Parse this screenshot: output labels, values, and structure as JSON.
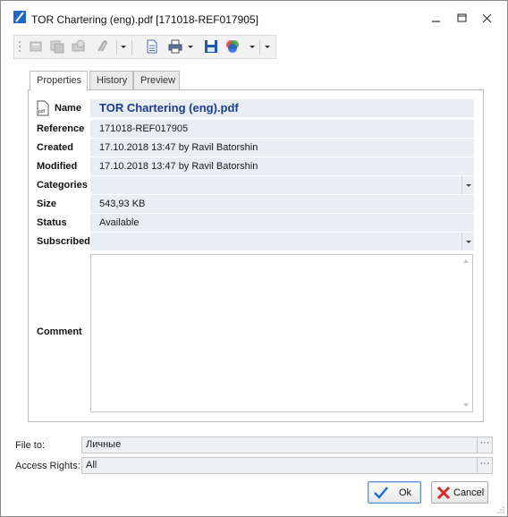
{
  "window": {
    "title": "TOR Chartering (eng).pdf [171018-REF017905]"
  },
  "titlebar_controls": {
    "minimize_icon": "minimize-icon",
    "restore_icon": "restore-icon",
    "close_icon": "close-icon"
  },
  "toolbar": {
    "icons": [
      "open-icon",
      "copy-icon",
      "print-preview-icon",
      "attach-icon",
      "document-icon",
      "printer-icon",
      "save-icon",
      "color-wheel-icon"
    ]
  },
  "tabs": [
    {
      "label": "Properties",
      "active": true
    },
    {
      "label": "History",
      "active": false
    },
    {
      "label": "Preview",
      "active": false
    }
  ],
  "properties": {
    "name_label": "Name",
    "name_value": "TOR Chartering (eng).pdf",
    "reference_label": "Reference",
    "reference_value": "171018-REF017905",
    "created_label": "Created",
    "created_value": "17.10.2018 13:47 by Ravil Batorshin",
    "modified_label": "Modified",
    "modified_value": "17.10.2018 13:47 by Ravil Batorshin",
    "categories_label": "Categories",
    "categories_value": "",
    "size_label": "Size",
    "size_value": "543,93 KB",
    "status_label": "Status",
    "status_value": "Available",
    "subscribed_label": "Subscribed",
    "subscribed_value": "",
    "comment_label": "Comment",
    "comment_value": ""
  },
  "bottom": {
    "file_to_label": "File to:",
    "file_to_value": "Личные",
    "access_rights_label": "Access Rights:",
    "access_rights_value": "All",
    "ellipsis": "···"
  },
  "buttons": {
    "ok_label": "Ok",
    "cancel_label": "Cancel"
  },
  "colors": {
    "accent": "#1b3c8f",
    "field_bg": "#e9eef3",
    "ok_check": "#1f66c9",
    "cancel_x": "#d62828"
  }
}
